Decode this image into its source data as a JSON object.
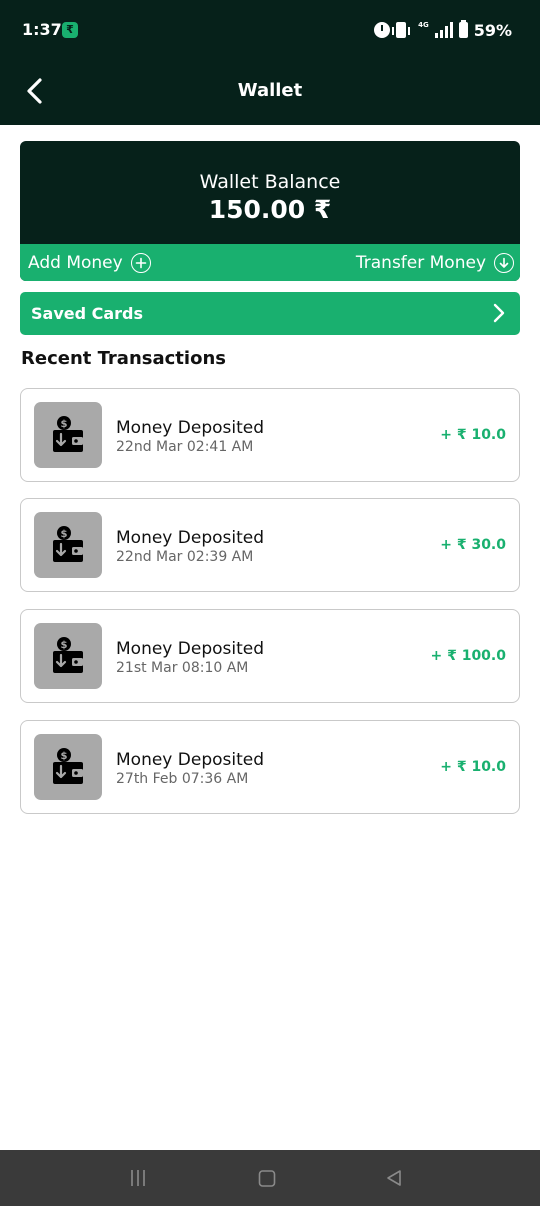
{
  "status_bar": {
    "time": "1:37",
    "network": "4G",
    "battery": "59%"
  },
  "app_bar": {
    "title": "Wallet"
  },
  "balance": {
    "label": "Wallet Balance",
    "amount": "150.00 ₹",
    "add_money_label": "Add Money",
    "transfer_money_label": "Transfer Money"
  },
  "saved_cards": {
    "label": "Saved Cards"
  },
  "recent": {
    "title": "Recent Transactions",
    "items": [
      {
        "title": "Money Deposited",
        "date": "22nd Mar 02:41 AM",
        "amount": "+ ₹ 10.0"
      },
      {
        "title": "Money Deposited",
        "date": "22nd Mar 02:39 AM",
        "amount": "+ ₹ 30.0"
      },
      {
        "title": "Money Deposited",
        "date": "21st Mar 08:10 AM",
        "amount": "+ ₹ 100.0"
      },
      {
        "title": "Money Deposited",
        "date": "27th Feb 07:36 AM",
        "amount": "+ ₹ 10.0"
      }
    ]
  },
  "colors": {
    "dark": "#06211a",
    "accent": "#19b06f",
    "navbar": "#3a3a3a"
  },
  "icons": {
    "back": "chevron-left-icon",
    "add": "plus-circle-icon",
    "transfer": "arrow-down-circle-icon",
    "saved_cards": "chevron-right-icon",
    "transaction": "wallet-deposit-icon"
  }
}
